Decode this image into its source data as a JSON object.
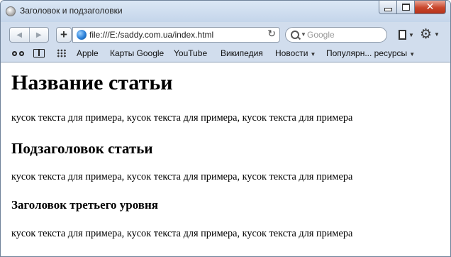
{
  "window": {
    "title": "Заголовок и подзаголовки"
  },
  "toolbar": {
    "url": "file:///E:/saddy.com.ua/index.html",
    "search_placeholder": "Google"
  },
  "bookmarks": {
    "items": [
      {
        "label": "Apple"
      },
      {
        "label": "Карты Google"
      },
      {
        "label": "YouTube"
      },
      {
        "label": "Википедия"
      },
      {
        "label": "Новости"
      },
      {
        "label": "Популярн... ресурсы"
      }
    ]
  },
  "page": {
    "h1": "Название статьи",
    "paragraphs": [
      "кусок текста для примера, кусок текста для примера, кусок текста для примера",
      "кусок текста для примера, кусок текста для примера, кусок текста для примера",
      "кусок текста для примера, кусок текста для примера, кусок текста для примера"
    ],
    "h2": "Подзаголовок статьи",
    "h3": "Заголовок третьего уровня"
  },
  "icons": {
    "app": "safari-compass-icon",
    "back": "back-arrow-icon",
    "forward": "forward-arrow-icon",
    "add": "plus-icon",
    "url": "globe-icon",
    "reload": "reload-icon",
    "search": "search-icon",
    "page_menu": "document-icon",
    "settings": "gear-icon"
  }
}
